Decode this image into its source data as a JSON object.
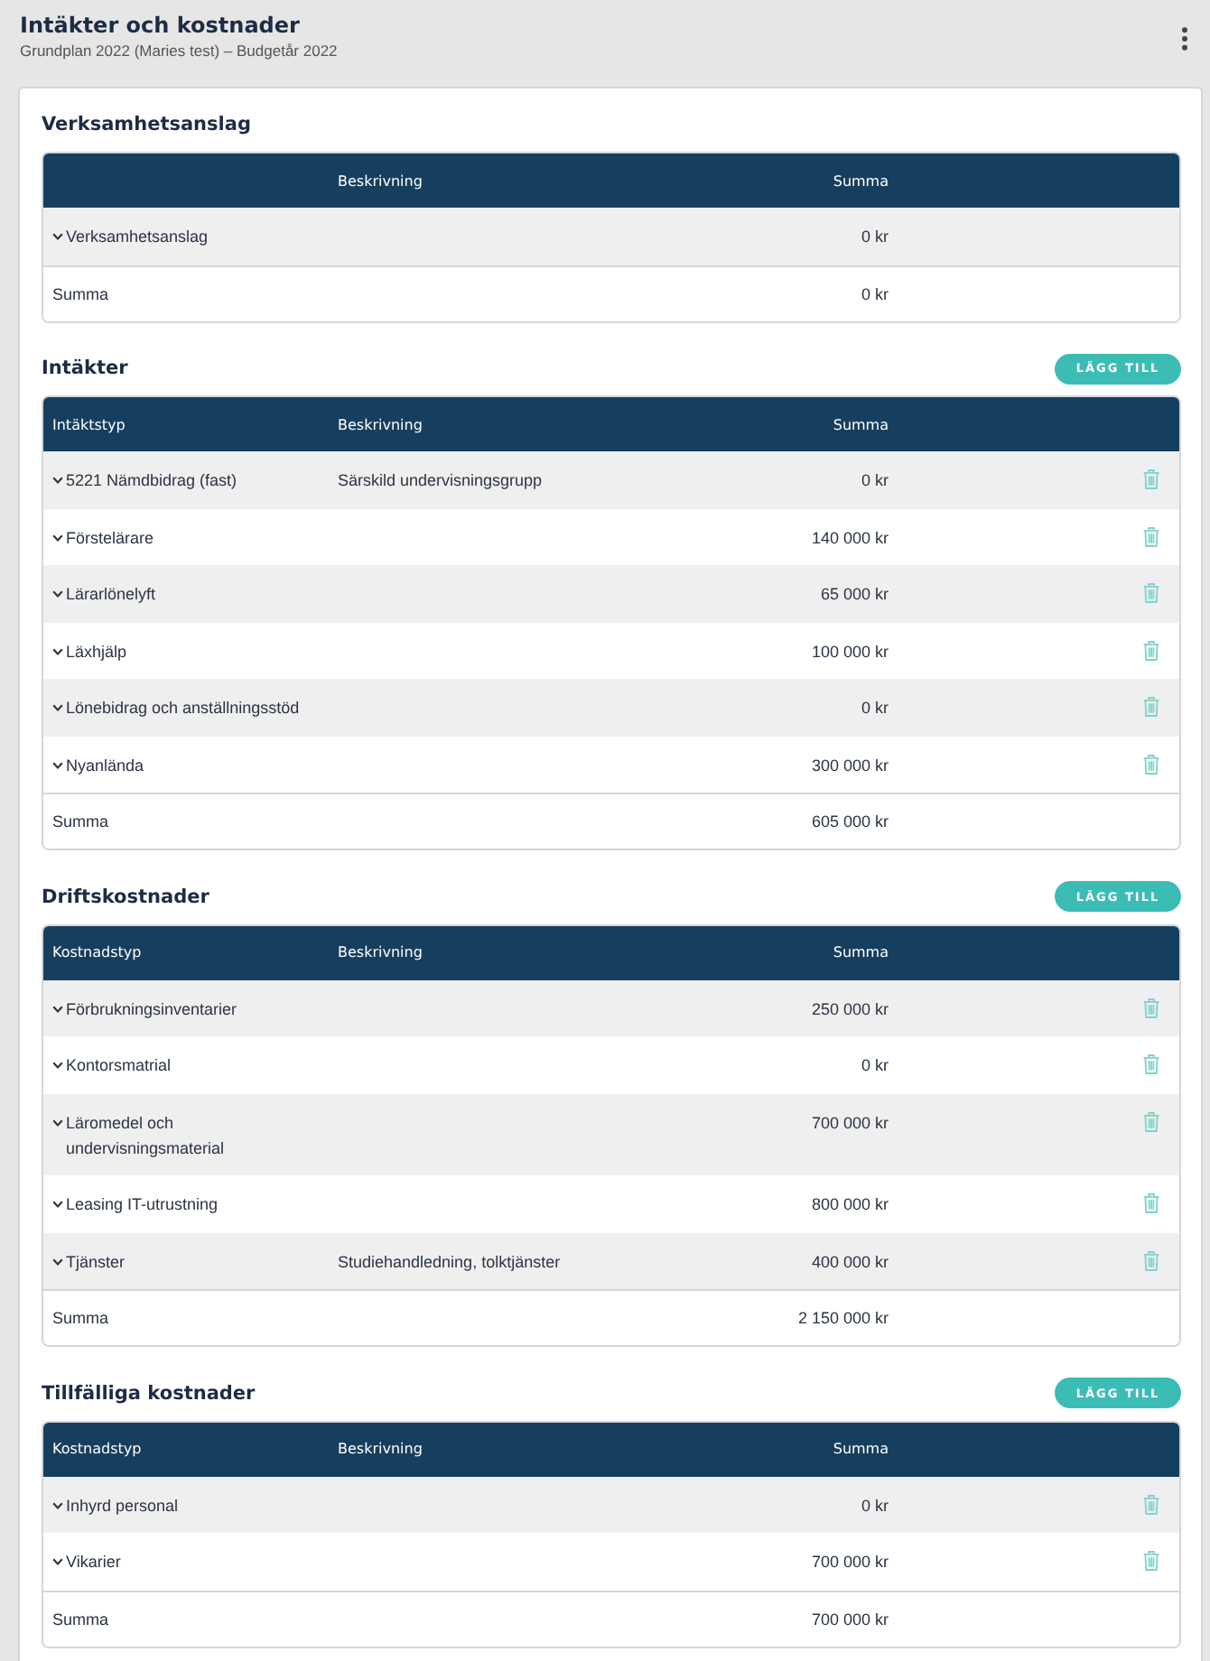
{
  "header": {
    "title": "Intäkter och kostnader",
    "subtitle": "Grundplan 2022 (Maries test) – Budgetår 2022"
  },
  "sections": [
    {
      "title": "Verksamhetsanslag",
      "headers": {
        "description": "Beskrivning",
        "amount": "Summa"
      },
      "rows": [
        {
          "type": "Verksamhetsanslag",
          "amount": "0 kr",
          "deletable": false
        }
      ],
      "total": {
        "label": "Summa",
        "amount": "0 kr"
      }
    },
    {
      "title": "Intäkter",
      "add_button": "LÄGG TILL",
      "headers": {
        "type": "Intäktstyp",
        "description": "Beskrivning",
        "amount": "Summa"
      },
      "rows": [
        {
          "type": "5221 Nämdbidrag (fast)",
          "description": "Särskild undervisningsgrupp",
          "amount": "0 kr",
          "deletable": true
        },
        {
          "type": "Förstelärare",
          "amount": "140 000 kr",
          "deletable": true
        },
        {
          "type": "Lärarlönelyft",
          "amount": "65 000 kr",
          "deletable": true
        },
        {
          "type": "Läxhjälp",
          "amount": "100 000 kr",
          "deletable": true
        },
        {
          "type": "Lönebidrag och anställningsstöd",
          "amount": "0 kr",
          "deletable": true
        },
        {
          "type": "Nyanlända",
          "amount": "300 000 kr",
          "deletable": true
        }
      ],
      "total": {
        "label": "Summa",
        "amount": "605 000 kr"
      }
    },
    {
      "title": "Driftskostnader",
      "add_button": "LÄGG TILL",
      "headers": {
        "type": "Kostnadstyp",
        "description": "Beskrivning",
        "amount": "Summa"
      },
      "rows": [
        {
          "type": "Förbrukningsinventarier",
          "amount": "250 000 kr",
          "deletable": true
        },
        {
          "type": "Kontorsmatrial",
          "amount": "0 kr",
          "deletable": true
        },
        {
          "type": "Läromedel och undervisningsmaterial",
          "amount": "700 000 kr",
          "deletable": true
        },
        {
          "type": "Leasing IT-utrustning",
          "amount": "800 000 kr",
          "deletable": true
        },
        {
          "type": "Tjänster",
          "description": "Studiehandledning, tolktjänster",
          "amount": "400 000 kr",
          "deletable": true
        }
      ],
      "total": {
        "label": "Summa",
        "amount": "2 150 000 kr"
      }
    },
    {
      "title": "Tillfälliga kostnader",
      "add_button": "LÄGG TILL",
      "headers": {
        "type": "Kostnadstyp",
        "description": "Beskrivning",
        "amount": "Summa"
      },
      "rows": [
        {
          "type": "Inhyrd personal",
          "amount": "0 kr",
          "deletable": true
        },
        {
          "type": "Vikarier",
          "amount": "700 000 kr",
          "deletable": true
        }
      ],
      "total": {
        "label": "Summa",
        "amount": "700 000 kr"
      }
    }
  ]
}
